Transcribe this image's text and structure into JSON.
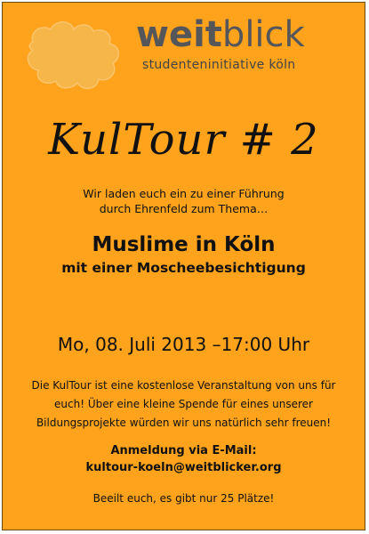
{
  "brand": {
    "logo_icon": "puzzle-piece-icon",
    "name_bold": "weit",
    "name_rest": "blick",
    "tagline": "studenteninitiative köln"
  },
  "event": {
    "title": "KulTour # 2",
    "intro_line1": "Wir laden euch ein zu einer Führung",
    "intro_line2": "durch Ehrenfeld  zum Thema…",
    "topic": "Muslime in Köln",
    "subtopic": "mit einer Moscheebesichtigung",
    "datetime": "Mo, 08. Juli 2013 –17:00 Uhr",
    "description": "Die KulTour ist eine kostenlose Veranstaltung von uns für euch! Über eine kleine Spende für eines unserer Bildungsprojekte würden wir uns natürlich sehr freuen!",
    "registration_label": "Anmeldung via E-Mail:",
    "registration_email": "kultour-koeln@weitblicker.org",
    "closing_note": "Beeilt euch, es gibt nur 25 Plätze!"
  },
  "colors": {
    "background": "#ffa21c",
    "puzzle": "#f7b64a",
    "brand_text": "#55565a"
  }
}
